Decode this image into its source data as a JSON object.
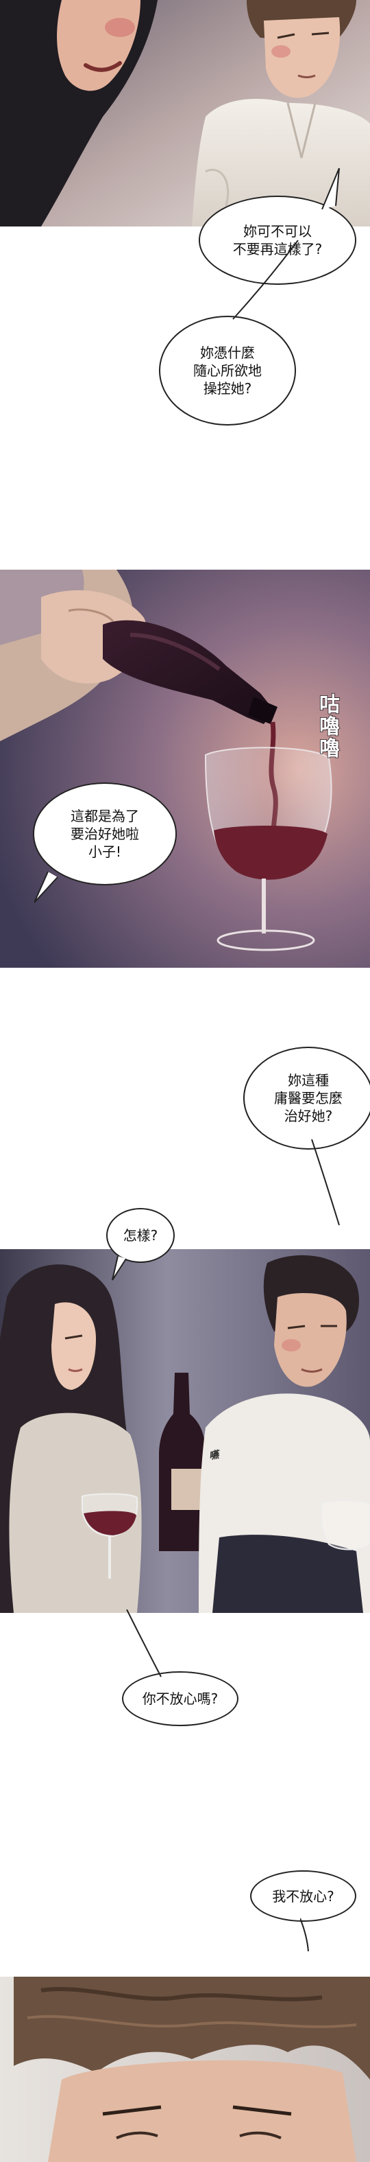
{
  "panels": [
    {
      "id": "panel-1",
      "description_name": "argument-closeup"
    },
    {
      "id": "panel-2",
      "description_name": "wine-pouring"
    },
    {
      "id": "panel-3",
      "description_name": "couple-at-bar"
    },
    {
      "id": "panel-4",
      "description_name": "man-closeup"
    }
  ],
  "bubbles": {
    "b1": "妳可不可以\n不要再這樣了?",
    "b2": "妳憑什麼\n隨心所欲地\n操控她?",
    "b3": "這都是為了\n要治好她啦\n小子!",
    "b4": "妳這種\n庸醫要怎麼\n治好她?",
    "b5": "怎樣?",
    "b6": "你不放心嗎?",
    "b7": "我不放心?"
  },
  "sfx": {
    "pour": "咕嚕嚕",
    "small": "嚥"
  },
  "colors": {
    "panel_bg_dark": "#3a3a45",
    "wine": "#6b1f2e",
    "bubble_border": "#222222"
  }
}
